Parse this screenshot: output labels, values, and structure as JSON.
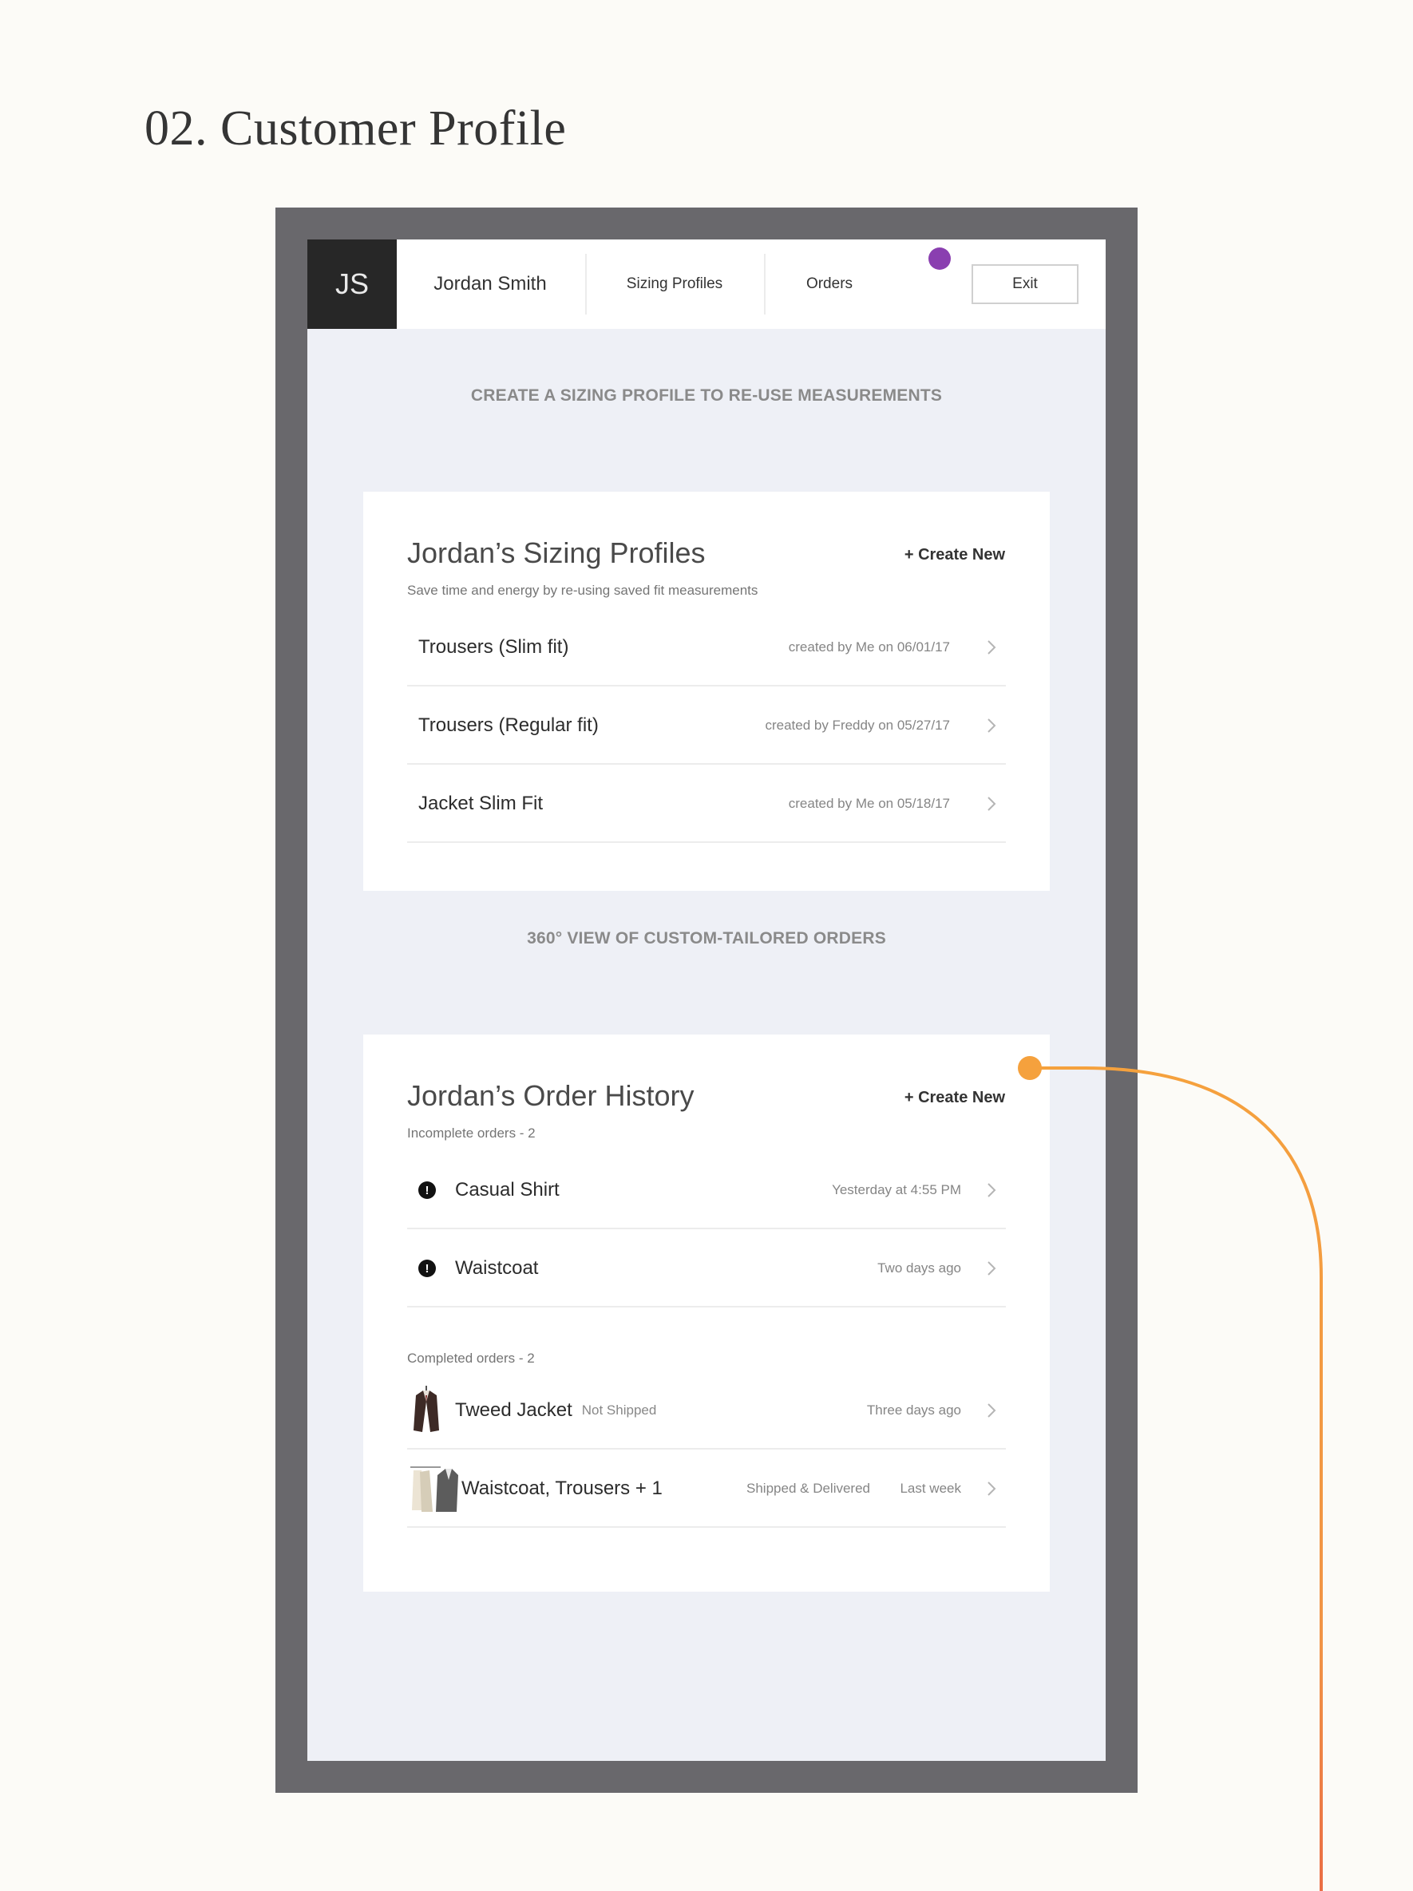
{
  "page": {
    "title": "02. Customer Profile"
  },
  "colors": {
    "background": "#fcfbf7",
    "device_frame": "#69686c",
    "screen": "#eef0f6",
    "avatar": "#272727",
    "purple_marker": "#8a3fb0",
    "orange_marker": "#f5a13d",
    "red_line": "#e0334d"
  },
  "topbar": {
    "initials": "JS",
    "user_name": "Jordan Smith",
    "nav_sizing": "Sizing Profiles",
    "nav_orders": "Orders",
    "exit_label": "Exit"
  },
  "sizing_section": {
    "heading": "CREATE A SIZING PROFILE TO RE-USE MEASUREMENTS",
    "title": "Jordan’s Sizing Profiles",
    "subtitle": "Save time and energy by re-using saved fit measurements",
    "create_label": "+ Create New",
    "items": [
      {
        "name": "Trousers (Slim fit)",
        "meta": "created by Me on 06/01/17"
      },
      {
        "name": "Trousers (Regular fit)",
        "meta": "created by Freddy on 05/27/17"
      },
      {
        "name": "Jacket Slim Fit",
        "meta": "created by Me on 05/18/17"
      }
    ]
  },
  "orders_section": {
    "heading": "360° VIEW OF CUSTOM-TAILORED ORDERS",
    "title": "Jordan’s Order History",
    "create_label": "+ Create New",
    "incomplete_label": "Incomplete orders - 2",
    "incomplete": [
      {
        "name": "Casual Shirt",
        "time": "Yesterday at 4:55 PM",
        "icon": "alert-icon"
      },
      {
        "name": "Waistcoat",
        "time": "Two days ago",
        "icon": "alert-icon"
      }
    ],
    "completed_label": "Completed orders - 2",
    "completed": [
      {
        "name": "Tweed Jacket",
        "status": "Not Shipped",
        "time": "Three days ago",
        "icon": "jacket-thumbnail"
      },
      {
        "name": "Waistcoat, Trousers + 1",
        "status": "Shipped & Delivered",
        "time": "Last week",
        "icon": "garments-thumbnail"
      }
    ]
  }
}
